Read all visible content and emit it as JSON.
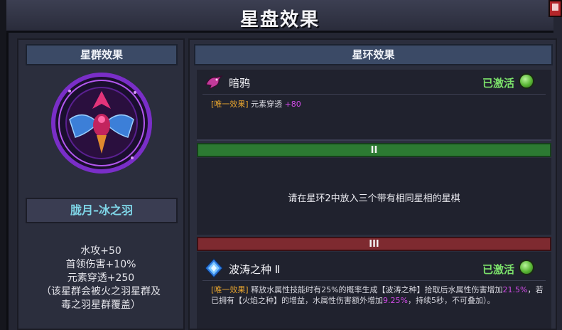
{
  "window": {
    "title": "星盘效果"
  },
  "colors": {
    "accent_orange": "#e8a52e",
    "highlight_magenta": "#d24be8",
    "active_green": "#7be06a",
    "name_cyan": "#7fd6e8",
    "tier2_green": "#2c7a32",
    "tier3_red": "#7e2a30"
  },
  "left_panel": {
    "header": "星群效果",
    "constellation_name": "胧月–冰之羽",
    "emblem_icon": "ice-feather-emblem-icon",
    "stats": [
      "水攻+50",
      "首领伤害+10%",
      "元素穿透+250",
      "（该星群会被火之羽星群及",
      "毒之羽星群覆盖）"
    ]
  },
  "right_panel": {
    "header": "星环效果",
    "ring1": {
      "name": "暗鸦",
      "icon": "dark-crow-icon",
      "status": "已激活",
      "effect_tag": "[唯一效果]",
      "effect_text": " 元素穿透 ",
      "effect_value": "+80"
    },
    "tier2": {
      "label": "II",
      "locked_text": "请在星环2中放入三个带有相同星相的星棋"
    },
    "tier3": {
      "label": "III"
    },
    "ring3": {
      "name": "波涛之种 Ⅱ",
      "icon": "blue-crystal-icon",
      "status": "已激活",
      "effect_tag": "[唯一效果]",
      "effect_text_1": " 释放水属性技能时有25%的概率生成【波涛之种】拾取后水属性伤害增加",
      "effect_value_1": "21.5%",
      "effect_text_2": "，若已拥有【火焰之种】的增益，水属性伤害额外增加",
      "effect_value_2": "9.25%",
      "effect_text_3": "，持续5秒，不可叠加）。"
    }
  }
}
